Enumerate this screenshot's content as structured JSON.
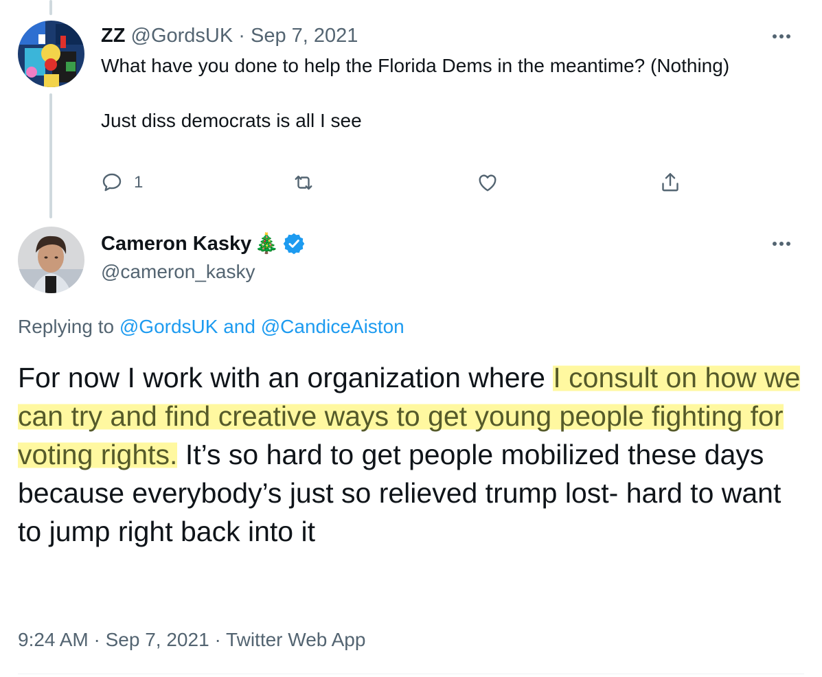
{
  "reply_tweet": {
    "display_name": "ZZ",
    "handle": "@GordsUK",
    "separator": "·",
    "date": "Sep 7, 2021",
    "text_lines": [
      "What have you done to help the Florida Dems in the meantime? (Nothing)",
      "Just diss democrats is all I see"
    ],
    "reply_count": "1",
    "icons": [
      "comment-icon",
      "retweet-icon",
      "heart-icon",
      "share-icon",
      "more-icon"
    ]
  },
  "main_tweet": {
    "display_name": "Cameron Kasky",
    "name_emoji": "🎄",
    "handle": "@cameron_kasky",
    "replying_prefix": "Replying to",
    "replying_user1": "@GordsUK",
    "replying_and": "and",
    "replying_user2": "@CandiceAiston",
    "body": {
      "part1": "For now I work with an organization where ",
      "highlight": "I consult on how we can try and find creative ways to get young people fighting for voting rights.",
      "part2": " It’s so hard to get people mobilized these days because everybody’s just so relieved trump lost- hard to want to jump right back into it"
    },
    "time": "9:24 AM",
    "date": "Sep 7, 2021",
    "source": "Twitter Web App",
    "separator": "·"
  },
  "colors": {
    "text": "#0f1419",
    "muted": "#536471",
    "link": "#1d9bf0",
    "highlight": "#fff578",
    "thread_line": "#cfd9de"
  }
}
